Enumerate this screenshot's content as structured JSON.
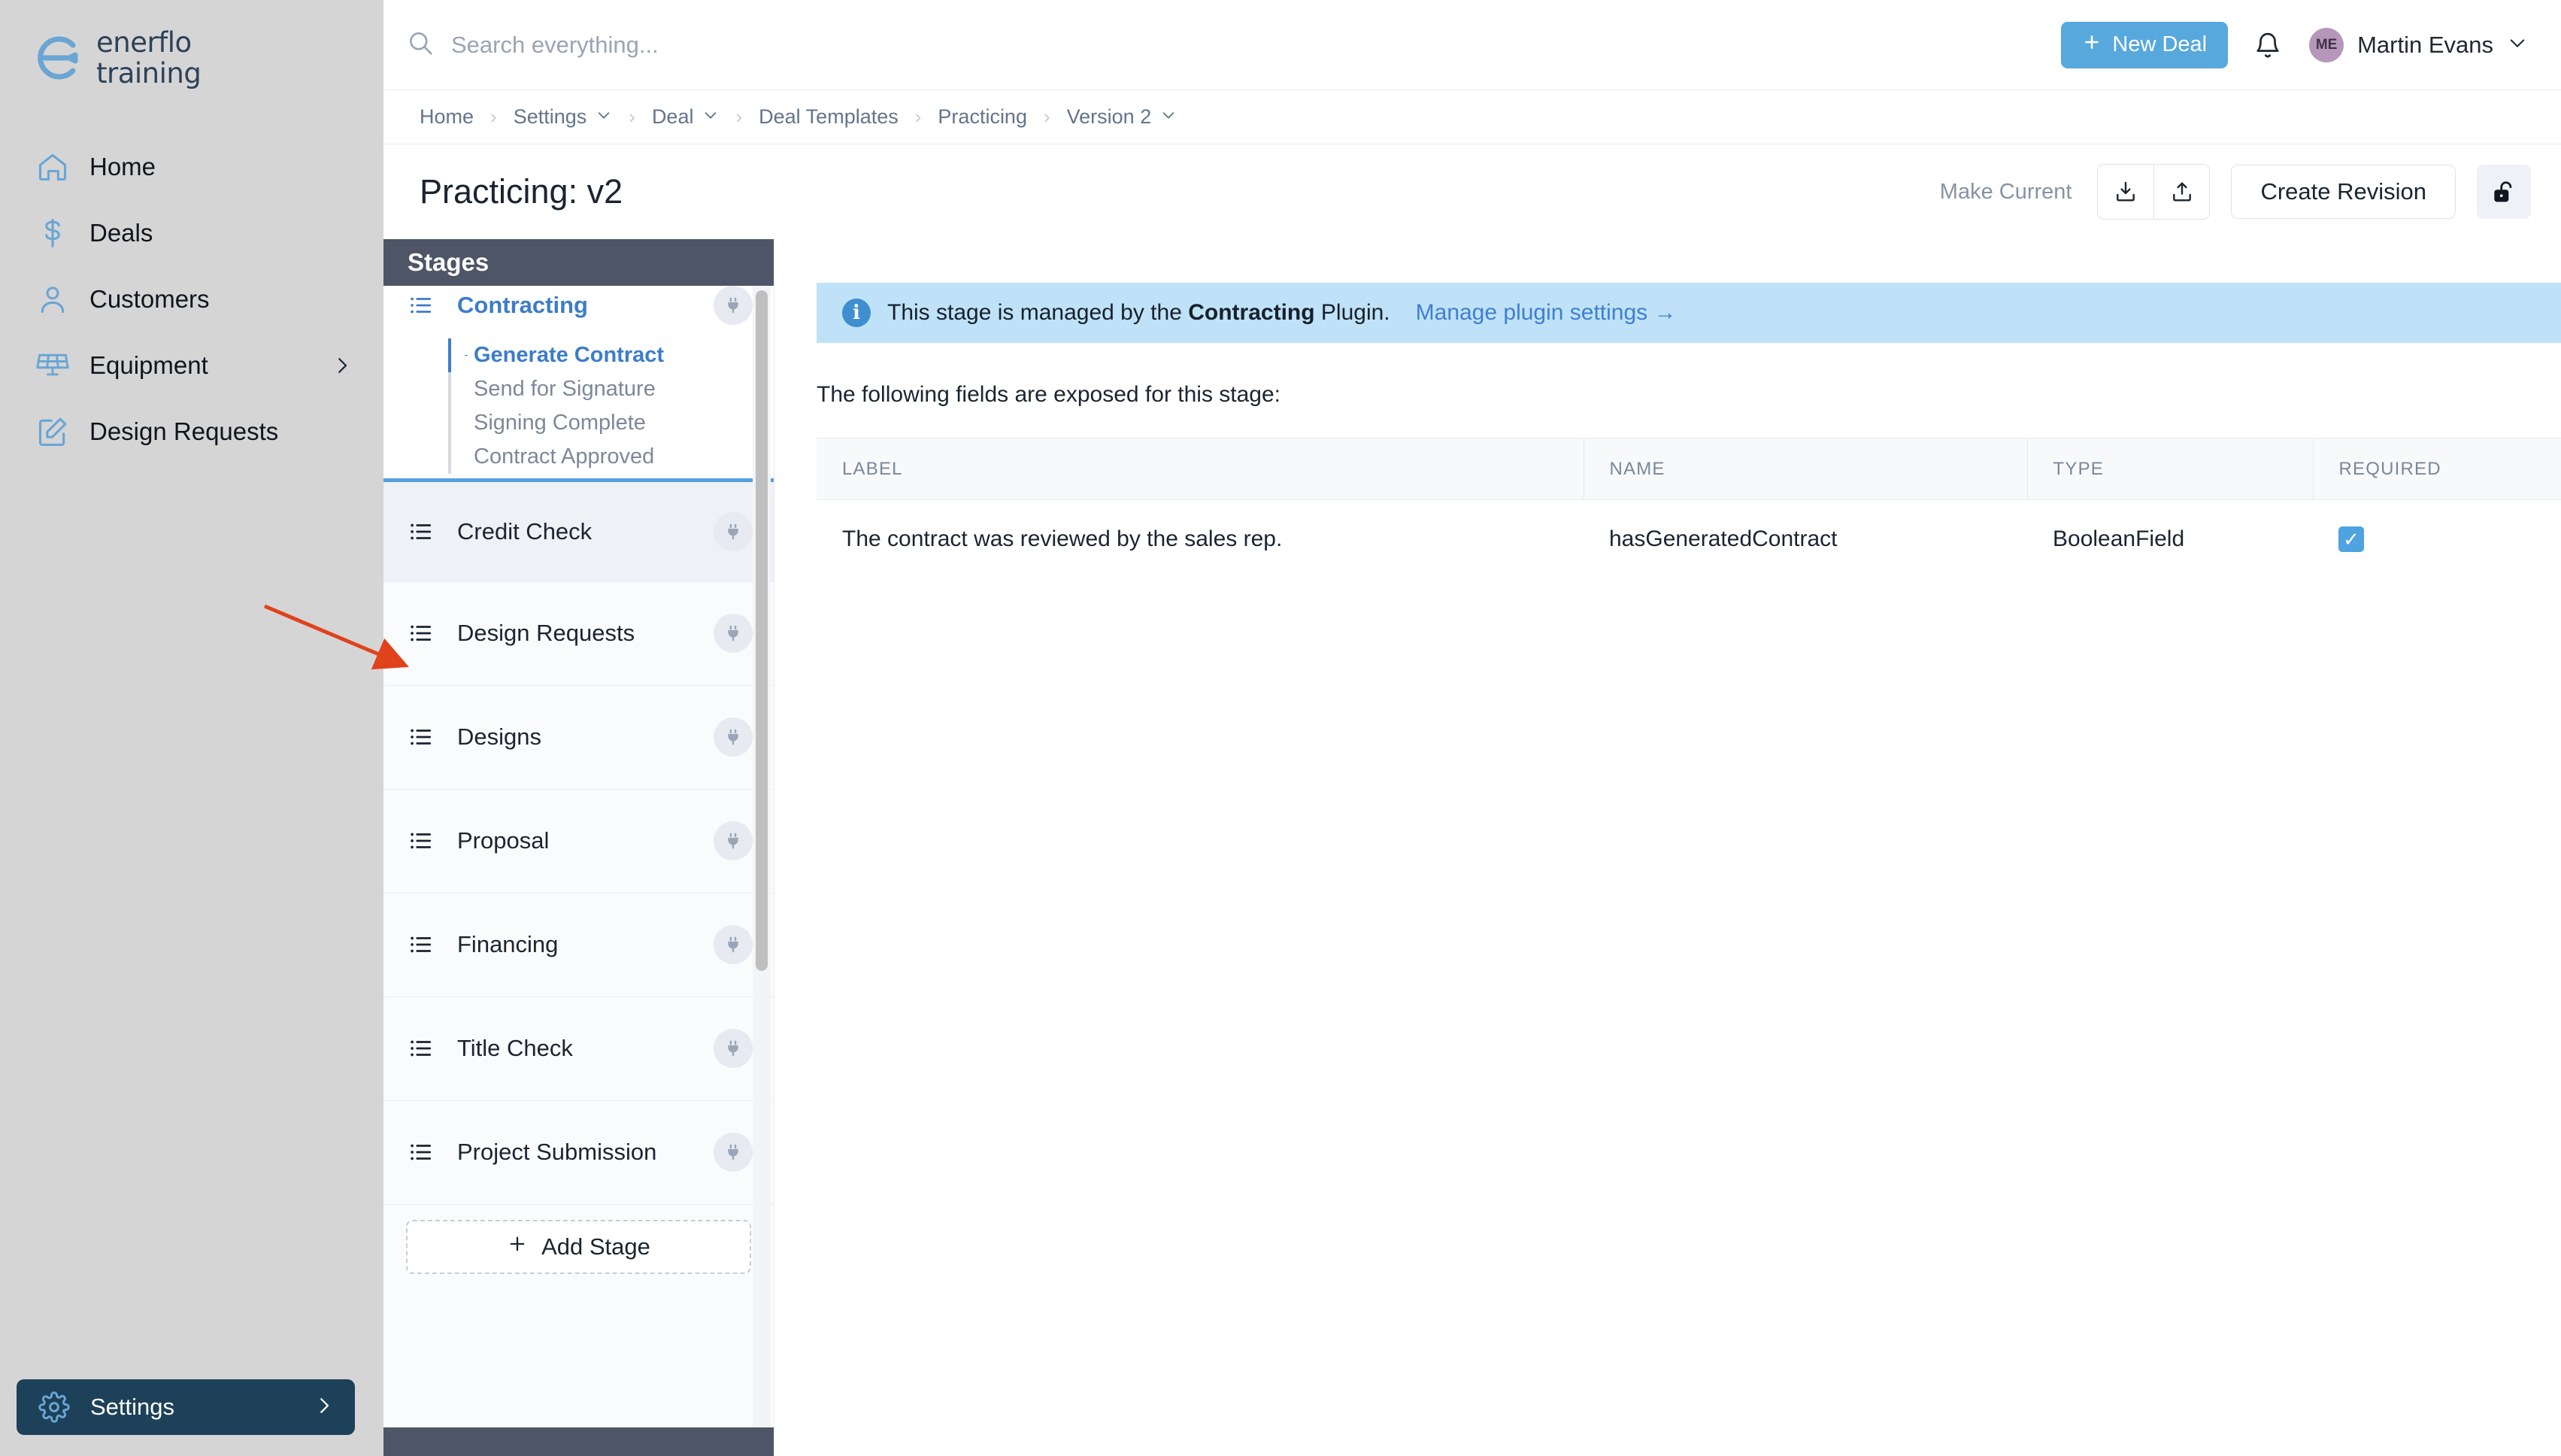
{
  "brand": {
    "line1": "enerflo",
    "line2": "training",
    "logo_color": "#6aa6d4",
    "wordmark_color": "#2d4257"
  },
  "sidebar": {
    "items": [
      {
        "label": "Home",
        "icon": "home-icon",
        "has_chevron": false
      },
      {
        "label": "Deals",
        "icon": "dollar-icon",
        "has_chevron": false
      },
      {
        "label": "Customers",
        "icon": "user-icon",
        "has_chevron": false
      },
      {
        "label": "Equipment",
        "icon": "solar-panel-icon",
        "has_chevron": true
      },
      {
        "label": "Design Requests",
        "icon": "pencil-square-icon",
        "has_chevron": false
      }
    ],
    "settings": {
      "label": "Settings",
      "icon": "gear-icon",
      "bg": "#1d4159"
    }
  },
  "topbar": {
    "search_placeholder": "Search everything...",
    "search_value": "",
    "new_deal_label": "New Deal",
    "new_deal_color": "#57a8dd",
    "notifications_icon": "bell-icon",
    "user": {
      "initials": "ME",
      "name": "Martin Evans",
      "avatar_color": "#b697bc"
    }
  },
  "breadcrumb": {
    "items": [
      {
        "label": "Home",
        "caret": false
      },
      {
        "label": "Settings",
        "caret": true
      },
      {
        "label": "Deal",
        "caret": true
      },
      {
        "label": "Deal Templates",
        "caret": false
      },
      {
        "label": "Practicing",
        "caret": false
      },
      {
        "label": "Version 2",
        "caret": true
      }
    ],
    "separator": "›"
  },
  "page": {
    "title": "Practicing: v2",
    "make_current_label": "Make Current",
    "download_icon": "download-icon",
    "upload_icon": "upload-icon",
    "create_revision_label": "Create Revision",
    "lock_icon": "unlock-icon"
  },
  "stages": {
    "header": "Stages",
    "add_stage_label": "Add Stage",
    "add_stage_icon": "plus-icon",
    "items": [
      {
        "label": "Contracting",
        "icon": "list-icon",
        "plug_icon": "plug-icon",
        "state": "expanded",
        "substages": [
          {
            "label": "Generate Contract",
            "active": true
          },
          {
            "label": "Send for Signature",
            "active": false
          },
          {
            "label": "Signing Complete",
            "active": false
          },
          {
            "label": "Contract Approved",
            "active": false
          }
        ]
      },
      {
        "label": "Credit Check",
        "icon": "list-icon",
        "plug_icon": "plug-icon",
        "state": "active",
        "substages": []
      },
      {
        "label": "Design Requests",
        "icon": "list-icon",
        "plug_icon": "plug-icon",
        "state": "normal",
        "substages": []
      },
      {
        "label": "Designs",
        "icon": "list-icon",
        "plug_icon": "plug-icon",
        "state": "normal",
        "substages": []
      },
      {
        "label": "Proposal",
        "icon": "list-icon",
        "plug_icon": "plug-icon",
        "state": "normal",
        "substages": []
      },
      {
        "label": "Financing",
        "icon": "list-icon",
        "plug_icon": "plug-icon",
        "state": "normal",
        "substages": []
      },
      {
        "label": "Title Check",
        "icon": "list-icon",
        "plug_icon": "plug-icon",
        "state": "normal",
        "substages": []
      },
      {
        "label": "Project Submission",
        "icon": "list-icon",
        "plug_icon": "plug-icon",
        "state": "normal",
        "substages": []
      }
    ]
  },
  "main": {
    "banner": {
      "icon": "info-icon",
      "text_before": "This stage is managed by the ",
      "plugin_name": "Contracting",
      "text_after": " Plugin.",
      "link_label": "Manage plugin settings →",
      "bg": "#bfe2f8"
    },
    "fields_note": "The following fields are exposed for this stage:",
    "table": {
      "columns": [
        "LABEL",
        "NAME",
        "TYPE",
        "REQUIRED"
      ],
      "rows": [
        {
          "label": "The contract was reviewed by the sales rep.",
          "name": "hasGeneratedContract",
          "type": "BooleanField",
          "required": true
        }
      ]
    }
  },
  "annotation": {
    "arrow_color": "#e0431b"
  }
}
